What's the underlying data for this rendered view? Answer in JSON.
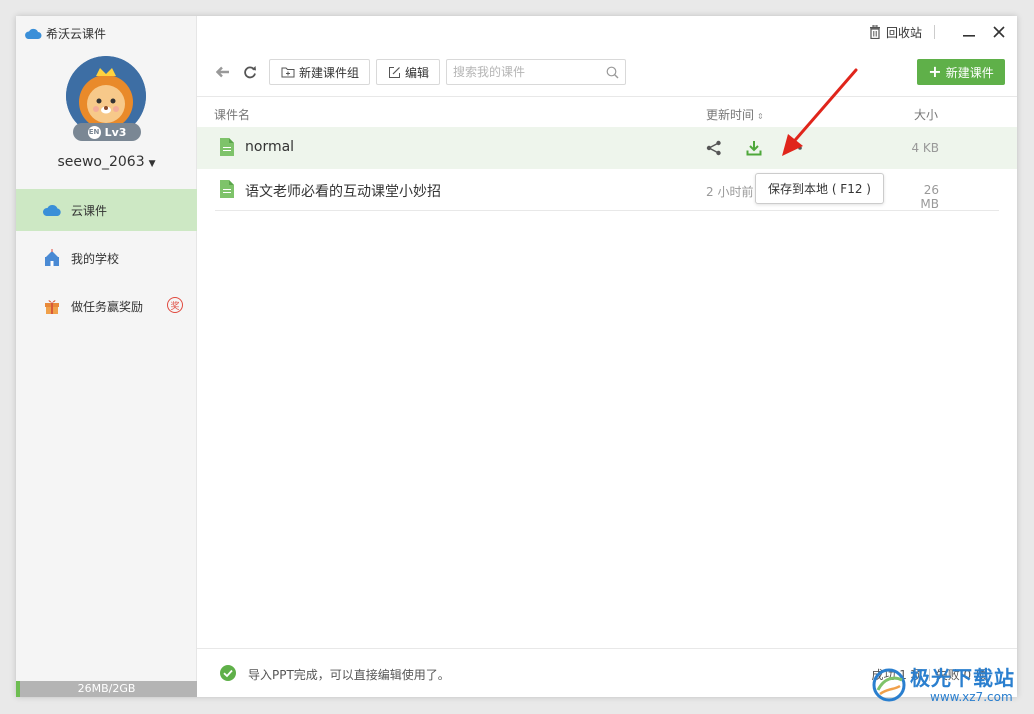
{
  "app": {
    "title": "希沃云课件"
  },
  "user": {
    "name": "seewo_2063",
    "level": "Lv3",
    "level_icon": "EN"
  },
  "sidebar": {
    "items": [
      {
        "label": "云课件",
        "icon": "cloud-icon",
        "active": true
      },
      {
        "label": "我的学校",
        "icon": "school-icon",
        "active": false
      },
      {
        "label": "做任务赢奖励",
        "icon": "gift-icon",
        "active": false,
        "badge": "奖"
      }
    ],
    "storage": {
      "label": "26MB/2GB",
      "used_fraction": 0.013
    }
  },
  "titlebar": {
    "recycle_label": "回收站"
  },
  "toolbar": {
    "new_group_label": "新建课件组",
    "edit_label": "编辑",
    "search_placeholder": "搜索我的课件",
    "new_courseware_label": "新建课件"
  },
  "table": {
    "columns": {
      "name": "课件名",
      "time": "更新时间",
      "size": "大小"
    },
    "rows": [
      {
        "name": "normal",
        "time": "",
        "size": "4 KB"
      },
      {
        "name": "语文老师必看的互动课堂小妙招",
        "time": "2 小时前",
        "size": "26 MB"
      }
    ]
  },
  "tooltip": {
    "text": "保存到本地 ( F12 )"
  },
  "footer": {
    "message": "导入PPT完成，可以直接编辑使用了。",
    "success": "成功 1 项",
    "fail": "失败 0 项"
  },
  "watermark": {
    "title": "极光下载站",
    "url": "www.xz7.com"
  },
  "colors": {
    "accent": "#5fb049",
    "active_nav": "#cde8c4",
    "arrow": "#e0251b"
  }
}
